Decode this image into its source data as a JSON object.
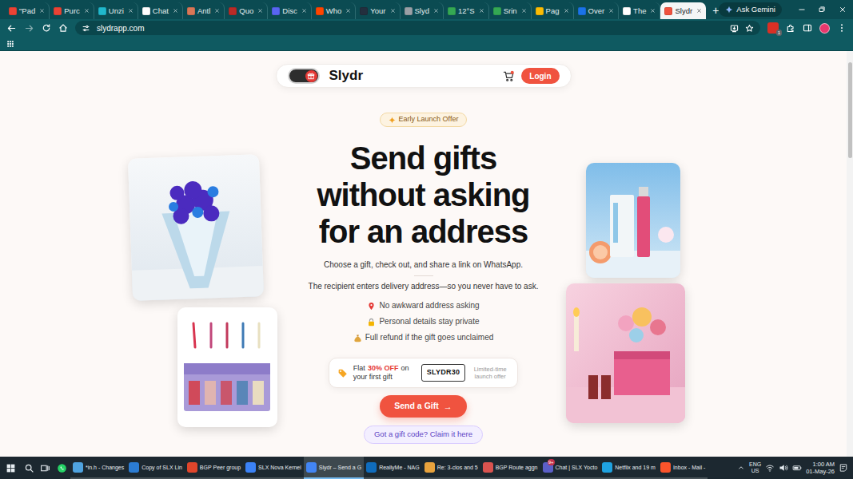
{
  "browser": {
    "tabs": [
      {
        "label": "\"Pad",
        "selected": false,
        "color": "#ea4335"
      },
      {
        "label": "Purc",
        "selected": false,
        "color": "#ea4335"
      },
      {
        "label": "Unzi",
        "selected": false,
        "color": "#20b8cd"
      },
      {
        "label": "Chat",
        "selected": false,
        "color": "#ffffff"
      },
      {
        "label": "Antl",
        "selected": false,
        "color": "#d97757"
      },
      {
        "label": "Quo",
        "selected": false,
        "color": "#b92b27"
      },
      {
        "label": "Disc",
        "selected": false,
        "color": "#5865f2"
      },
      {
        "label": "Who",
        "selected": false,
        "color": "#ff4500"
      },
      {
        "label": "Your",
        "selected": false,
        "color": "#232f3e"
      },
      {
        "label": "Slyd",
        "selected": false,
        "color": "#9aa0a6"
      },
      {
        "label": "12°S",
        "selected": false,
        "color": "#34a853"
      },
      {
        "label": "Srin",
        "selected": false,
        "color": "#34a853"
      },
      {
        "label": "Pag",
        "selected": false,
        "color": "#fbbc04"
      },
      {
        "label": "Over",
        "selected": false,
        "color": "#1a73e8"
      },
      {
        "label": "The",
        "selected": false,
        "color": "#ffffff"
      },
      {
        "label": "Slydr",
        "selected": true,
        "color": "#f0533f"
      }
    ],
    "new_tab": "+",
    "gemini": "Ask Gemini",
    "address": "slydrapp.com",
    "extension_badge": "1"
  },
  "page": {
    "logo": "Slydr",
    "login": "Login",
    "badge": "Early Launch Offer",
    "headline": [
      "Send gifts",
      "without asking",
      "for an address"
    ],
    "intro": [
      "Choose a gift, check out, and share a link on WhatsApp.",
      "The recipient enters delivery address—so you never have to ask."
    ],
    "features": [
      "No awkward address asking",
      "Personal details stay private",
      "Full refund if the gift goes unclaimed"
    ],
    "offer": {
      "prefix": "Flat",
      "highlight": "30% OFF",
      "suffix": "on your first gift",
      "code": "SLYDR30",
      "note": "Limited-time launch offer"
    },
    "cta": "Send a Gift",
    "cta_arrow": "→",
    "claim": "Got a gift code? Claim it here"
  },
  "taskbar": {
    "apps": [
      {
        "label": "*in.h - Changes",
        "selected": false,
        "color": "#4fa3e0"
      },
      {
        "label": "Copy of SLX Lin",
        "selected": false,
        "color": "#2b7cd3"
      },
      {
        "label": "BGP Peer group",
        "selected": false,
        "color": "#e0452b"
      },
      {
        "label": "SLX Nova Kernel",
        "selected": false,
        "color": "#3b82f6"
      },
      {
        "label": "Slydr – Send a G",
        "selected": true,
        "color": "#4285f4"
      },
      {
        "label": "ReallyMe - NAG",
        "selected": false,
        "color": "#0f6cbd"
      },
      {
        "label": "Re: 3-clos and 5",
        "selected": false,
        "color": "#e8a33d"
      },
      {
        "label": "BGP Route aggn",
        "selected": false,
        "color": "#d9534f"
      },
      {
        "label": "Chat | SLX Yocto",
        "selected": false,
        "color": "#5b5fc7",
        "badge": "9+"
      },
      {
        "label": "Netflix and 19 m",
        "selected": false,
        "color": "#1fa2e0"
      },
      {
        "label": "Inbox - Mail -",
        "selected": false,
        "color": "#fb542b"
      }
    ],
    "language": "ENG",
    "region": "US",
    "time": "1:00 AM",
    "date": "01-May-26"
  }
}
